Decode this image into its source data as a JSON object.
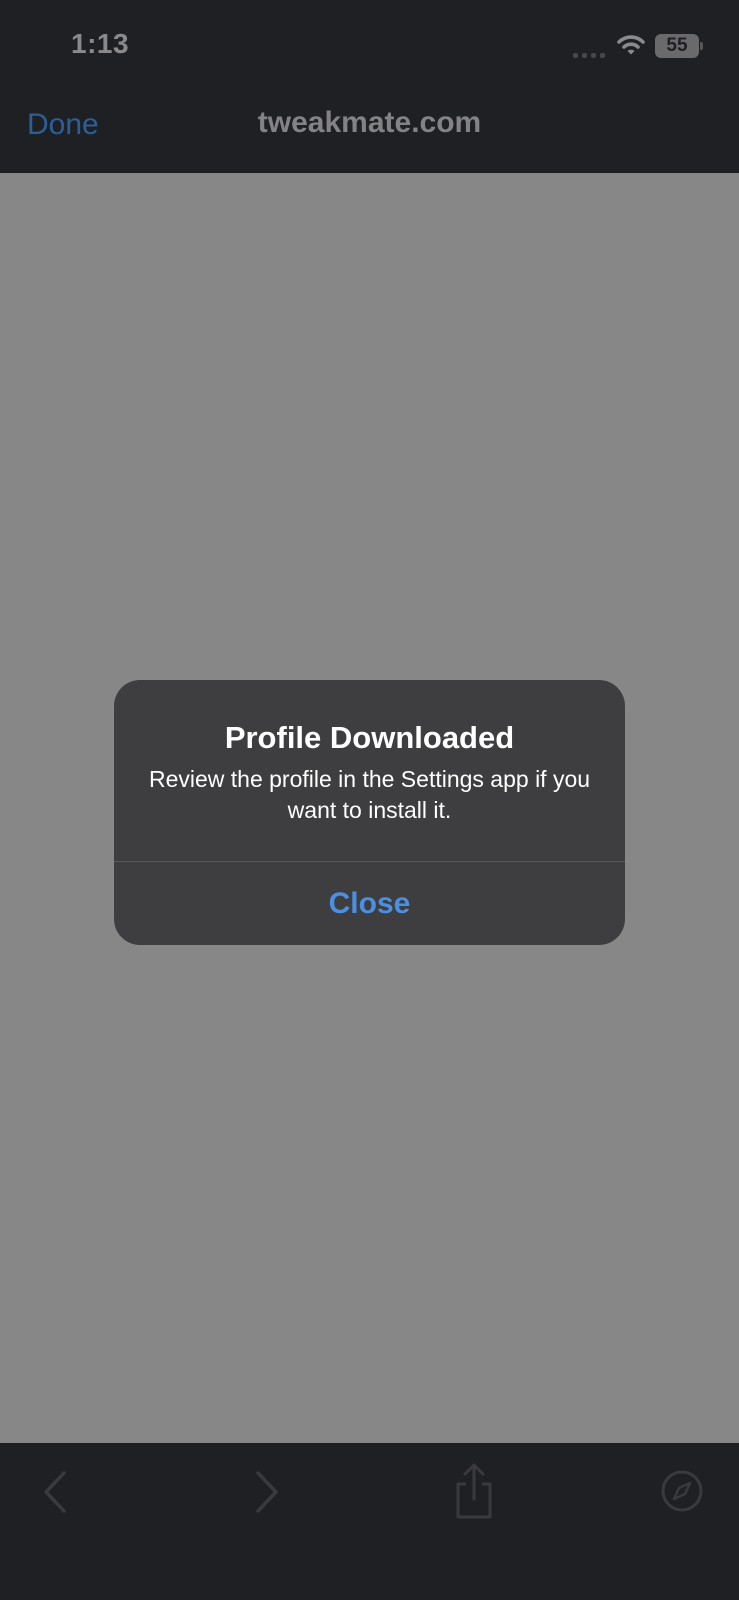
{
  "status_bar": {
    "time": "1:13",
    "battery_level": "55",
    "icons": [
      "signal-icon",
      "wifi-icon",
      "battery-icon"
    ]
  },
  "nav_bar": {
    "done_label": "Done",
    "url": "tweakmate.com"
  },
  "alert": {
    "title": "Profile Downloaded",
    "message": "Review the profile in the Settings app if you want to install it.",
    "close_label": "Close"
  },
  "toolbar": {
    "icons": [
      "back-icon",
      "forward-icon",
      "share-icon",
      "compass-icon"
    ]
  },
  "colors": {
    "background": "#1f2023",
    "page_dim": "#878787",
    "alert_bg": "#3e3e40",
    "accent": "#4a90e2",
    "done_dimmed": "#2c5e97"
  }
}
